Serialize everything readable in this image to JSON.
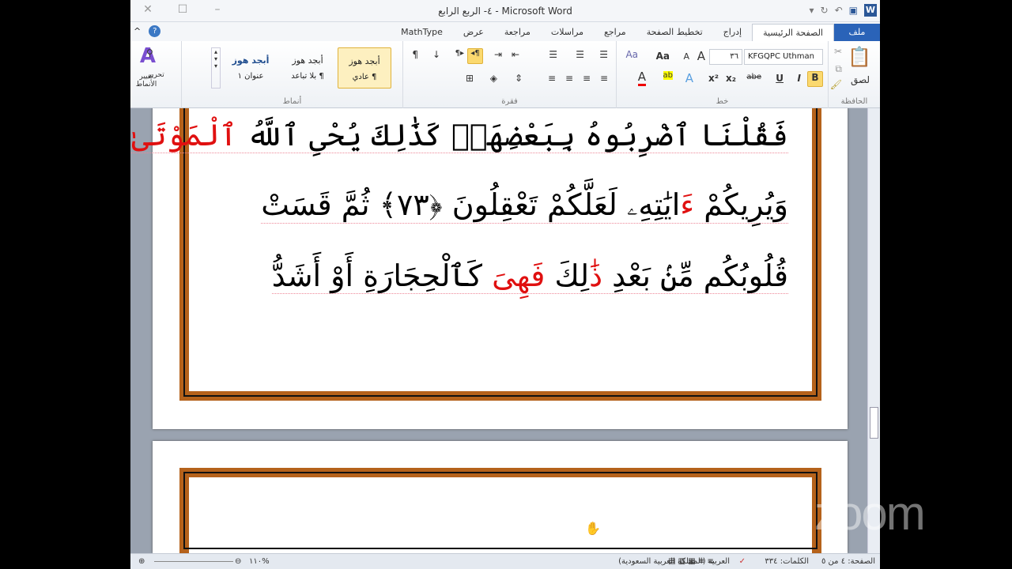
{
  "window": {
    "title": "٤- الربع الرابع  -  Microsoft Word"
  },
  "tabs": [
    {
      "label": "ملف"
    },
    {
      "label": "الصفحة الرئيسية"
    },
    {
      "label": "إدراج"
    },
    {
      "label": "تخطيط الصفحة"
    },
    {
      "label": "مراجع"
    },
    {
      "label": "مراسلات"
    },
    {
      "label": "مراجعة"
    },
    {
      "label": "عرض"
    },
    {
      "label": "MathType"
    }
  ],
  "ribbon": {
    "clipboard": {
      "label": "الحافظة",
      "paste": "لصق"
    },
    "font": {
      "label": "خط",
      "font_name": "KFGQPC Uthman",
      "font_size": "٣٦",
      "bold": "B",
      "italic": "I",
      "underline": "U",
      "strike": "abe",
      "sub": "x₂",
      "sup": "x²",
      "grow": "A",
      "shrink": "A",
      "case": "Aa"
    },
    "paragraph": {
      "label": "فقرة",
      "pilcrow": "¶"
    },
    "styles": {
      "label": "أنماط",
      "items": [
        {
          "sample": "أبجد هوز",
          "name": "¶ عادي"
        },
        {
          "sample": "أبجد هوز",
          "name": "¶ بلا تباعد"
        },
        {
          "sample": "أبجد هوز",
          "name": "عنوان ١"
        }
      ],
      "change": "تغيير الأنماط"
    },
    "editing": {
      "label": "تحرير"
    }
  },
  "document": {
    "lines": [
      [
        {
          "t": "فَقُلْنَا ٱضْرِبُوهُ بِبَعْضِهَاۚ كَذَٰلِكَ يُحْىِ ٱللَّهُ "
        },
        {
          "t": "ٱلْمَوْتَىٰ",
          "red": true
        }
      ],
      [
        {
          "t": "وَيُرِيكُمْ "
        },
        {
          "t": "ءَ",
          "red": true
        },
        {
          "t": "ايَٰتِهِۦ لَعَلَّكُمْ تَعْقِلُونَ ﴿٧٣﴾ ثُمَّ قَسَتْ"
        }
      ],
      [
        {
          "t": "قُلُوبُكُم مِّنۢ بَعْدِ "
        },
        {
          "t": "ذَٰ",
          "red": true
        },
        {
          "t": "لِكَ "
        },
        {
          "t": "فَهِىَ",
          "red": true
        },
        {
          "t": " كَٱلْحِجَارَةِ أَوْ أَشَدُّ"
        }
      ]
    ]
  },
  "status": {
    "page": "الصفحة: ٤ من ٥",
    "words": "الكلمات: ٣٣٤",
    "language": "العربية (المملكة العربية السعودية)",
    "zoom": "%١١٠"
  },
  "watermark": "zoom"
}
